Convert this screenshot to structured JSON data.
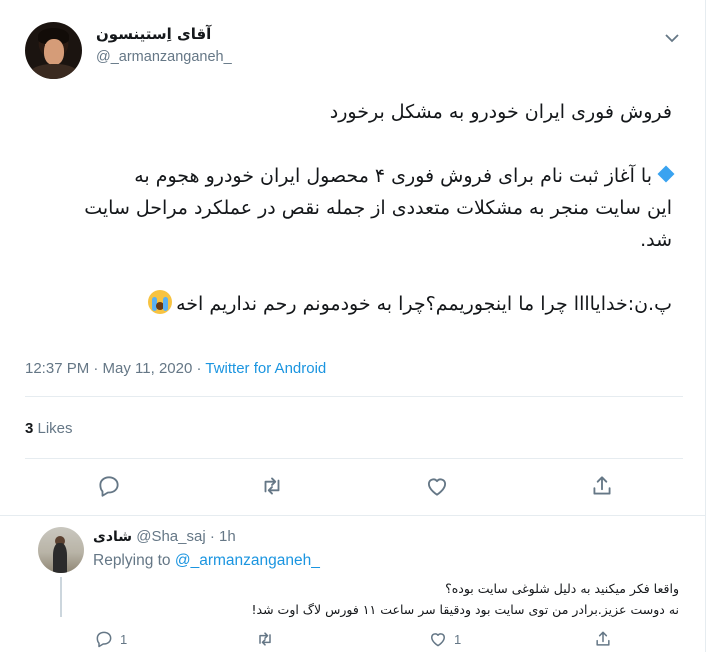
{
  "tweet": {
    "display_name": "آقای اِستینسون",
    "handle": "@_armanzanganeh_",
    "lines": [
      "فروش فوری ایران خودرو به مشکل برخورد",
      "با آغاز ثبت نام برای فروش فوری ۴ محصول ایران خودرو هجوم به",
      "این سایت منجر به مشکلات متعددی از جمله نقص در عملکرد مراحل سایت",
      "شد.",
      "پ.ن:خدایاااا چرا ما اینجوریمم؟چرا به خودمونم رحم نداریم اخه"
    ],
    "timestamp": "12:37 PM · May 11, 2020 · ",
    "source": "Twitter for Android",
    "likes_count": "3",
    "likes_label": " Likes",
    "icons": {
      "menu": "chevron-down-icon",
      "reply": "reply-icon",
      "retweet": "retweet-icon",
      "like": "heart-icon",
      "share": "share-icon",
      "bullet": "blue-diamond-icon",
      "emoji": "loudly-crying-face-icon"
    }
  },
  "reply": {
    "display_name": "شادی",
    "handle_time": " @Sha_saj · 1h",
    "replying_label": "Replying to ",
    "replying_to": "@_armanzanganeh_",
    "lines": [
      "واقعا فکر میکنید به دلیل شلوغی سایت بوده؟",
      "نه دوست عزیز.برادر من توی سایت بود ودقیقا  سر ساعت ۱۱ فورس لاگ اوت شد!"
    ],
    "reply_count": "1",
    "like_count": "1"
  },
  "colors": {
    "link": "#1b95e0",
    "muted": "#657786",
    "text": "#14171a",
    "divider": "#e6ecf0"
  }
}
